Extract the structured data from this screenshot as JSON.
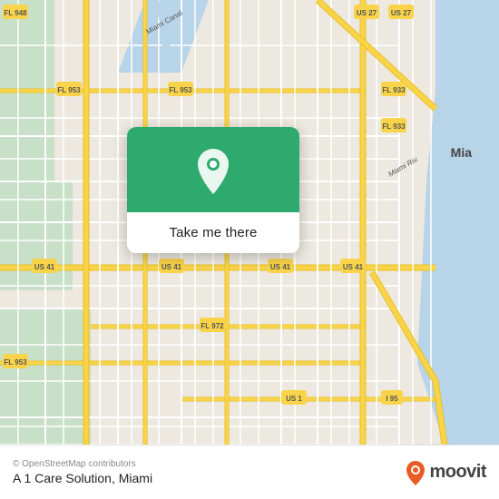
{
  "map": {
    "attribution": "© OpenStreetMap contributors",
    "miami_label": "Mia",
    "background_color": "#e8e0d8"
  },
  "card": {
    "button_label": "Take me there"
  },
  "footer": {
    "attribution": "© OpenStreetMap contributors",
    "location_label": "A 1 Care Solution, Miami",
    "logo_text": "moovit"
  }
}
